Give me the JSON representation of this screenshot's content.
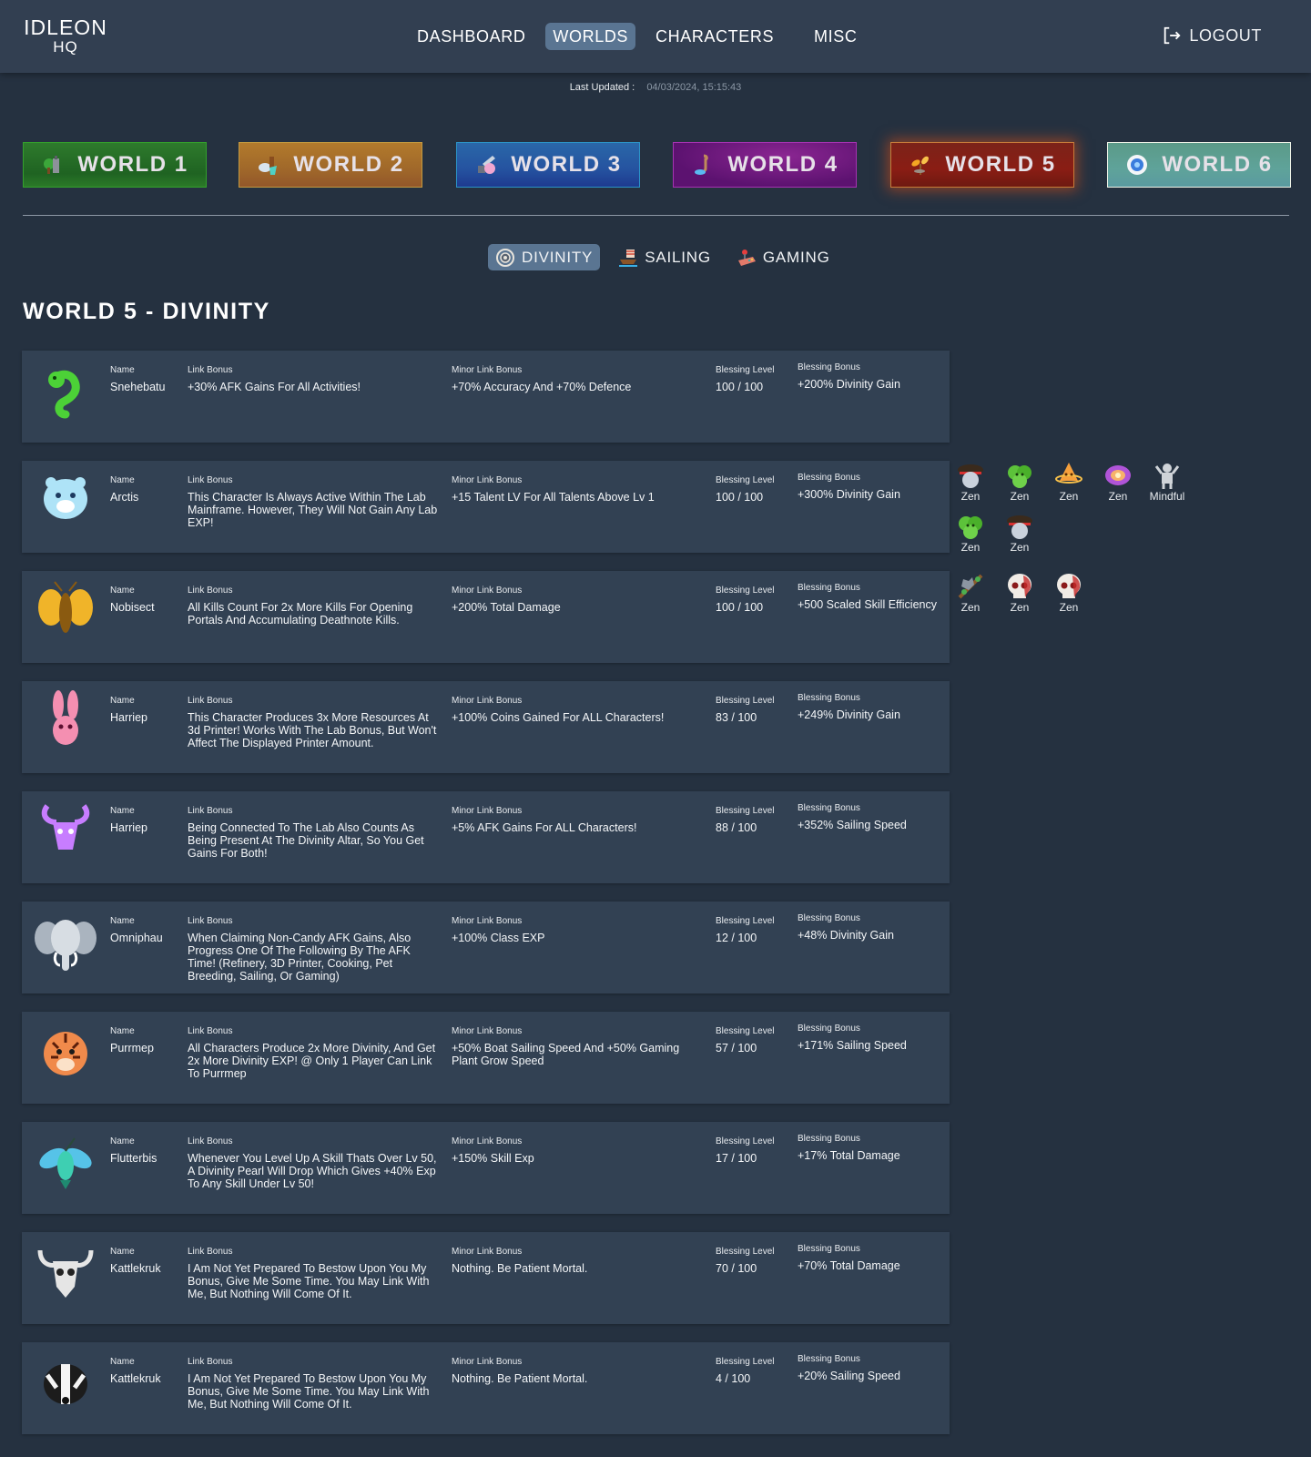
{
  "header": {
    "logo_line1": "IDLEON",
    "logo_line2": "HQ",
    "nav": [
      {
        "label": "DASHBOARD",
        "active": false
      },
      {
        "label": "WORLDS",
        "active": true
      },
      {
        "label": "CHARACTERS",
        "active": false
      },
      {
        "label": "MISC",
        "active": false
      }
    ],
    "logout_label": "LOGOUT",
    "logout_icon": "logout-icon"
  },
  "last_updated": {
    "label": "Last Updated :",
    "value": "04/03/2024, 15:15:43"
  },
  "worlds": [
    {
      "label": "WORLD 1",
      "icon": "world-1-icon",
      "active": false
    },
    {
      "label": "WORLD 2",
      "icon": "world-2-icon",
      "active": false
    },
    {
      "label": "WORLD 3",
      "icon": "world-3-icon",
      "active": false
    },
    {
      "label": "WORLD 4",
      "icon": "world-4-icon",
      "active": false
    },
    {
      "label": "WORLD 5",
      "icon": "world-5-icon",
      "active": true
    },
    {
      "label": "WORLD 6",
      "icon": "world-6-icon",
      "active": false
    }
  ],
  "subtabs": [
    {
      "label": "DIVINITY",
      "icon": "divinity-icon",
      "active": true
    },
    {
      "label": "SAILING",
      "icon": "sailing-ship-icon",
      "active": false
    },
    {
      "label": "GAMING",
      "icon": "gaming-joystick-icon",
      "active": false
    }
  ],
  "page_title": "WORLD 5 - DIVINITY",
  "column_labels": {
    "name": "Name",
    "link_bonus": "Link Bonus",
    "minor_link_bonus": "Minor Link Bonus",
    "blessing_level": "Blessing Level",
    "blessing_bonus": "Blessing Bonus"
  },
  "gods": [
    {
      "avatar": "snake-god-icon",
      "name": "Snehebatu",
      "link_bonus": "+30% AFK Gains For All Activities!",
      "minor_link_bonus": "+70% Accuracy And +70% Defence",
      "blessing_level": "100 / 100",
      "blessing_bonus": "+200% Divinity Gain",
      "color": "#4cd137"
    },
    {
      "avatar": "polar-bear-god-icon",
      "name": "Arctis",
      "link_bonus": "This Character Is Always Active Within The Lab Mainframe. However, They Will Not Gain Any Lab EXP!",
      "minor_link_bonus": "+15 Talent LV For All Talents Above Lv 1",
      "blessing_level": "100 / 100",
      "blessing_bonus": "+300% Divinity Gain",
      "color": "#aee3f7"
    },
    {
      "avatar": "moth-god-icon",
      "name": "Nobisect",
      "link_bonus": "All Kills Count For 2x More Kills For Opening Portals And Accumulating Deathnote Kills.",
      "minor_link_bonus": "+200% Total Damage",
      "blessing_level": "100 / 100",
      "blessing_bonus": "+500 Scaled Skill Efficiency",
      "color": "#f0b429"
    },
    {
      "avatar": "rabbit-god-icon",
      "name": "Harriep",
      "link_bonus": "This Character Produces 3x More Resources At 3d Printer! Works With The Lab Bonus, But Won't Affect The Displayed Printer Amount.",
      "minor_link_bonus": "+100% Coins Gained For ALL Characters!",
      "blessing_level": "83 / 100",
      "blessing_bonus": "+249% Divinity Gain",
      "color": "#f48fb1"
    },
    {
      "avatar": "goat-god-icon",
      "name": "Harriep",
      "link_bonus": "Being Connected To The Lab Also Counts As Being Present At The Divinity Altar, So You Get Gains For Both!",
      "minor_link_bonus": "+5% AFK Gains For ALL Characters!",
      "blessing_level": "88 / 100",
      "blessing_bonus": "+352% Sailing Speed",
      "color": "#c77dff"
    },
    {
      "avatar": "elephant-god-icon",
      "name": "Omniphau",
      "link_bonus": "When Claiming Non-Candy AFK Gains, Also Progress One Of The Following By The AFK Time! (Refinery, 3D Printer, Cooking, Pet Breeding, Sailing, Or Gaming)",
      "minor_link_bonus": "+100% Class EXP",
      "blessing_level": "12 / 100",
      "blessing_bonus": "+48% Divinity Gain",
      "color": "#d7dde3"
    },
    {
      "avatar": "tiger-god-icon",
      "name": "Purrmep",
      "link_bonus": "All Characters Produce 2x More Divinity, And Get 2x More Divinity EXP! @ Only 1 Player Can Link To Purrmep",
      "minor_link_bonus": "+50% Boat Sailing Speed And +50% Gaming Plant Grow Speed",
      "blessing_level": "57 / 100",
      "blessing_bonus": "+171% Sailing Speed",
      "color": "#f08a4b"
    },
    {
      "avatar": "hummingbird-god-icon",
      "name": "Flutterbis",
      "link_bonus": "Whenever You Level Up A Skill Thats Over Lv 50, A Divinity Pearl Will Drop Which Gives +40% Exp To Any Skill Under Lv 50!",
      "minor_link_bonus": "+150% Skill Exp",
      "blessing_level": "17 / 100",
      "blessing_bonus": "+17% Total Damage",
      "color": "#3ecfb2"
    },
    {
      "avatar": "bull-skull-god-icon",
      "name": "Kattlekruk",
      "link_bonus": "I Am Not Yet Prepared To Bestow Upon You My Bonus, Give Me Some Time. You May Link With Me, But Nothing Will Come Of It.",
      "minor_link_bonus": "Nothing. Be Patient Mortal.",
      "blessing_level": "70 / 100",
      "blessing_bonus": "+70% Total Damage",
      "color": "#e5e5e5"
    },
    {
      "avatar": "badger-god-icon",
      "name": "Kattlekruk",
      "link_bonus": "I Am Not Yet Prepared To Bestow Upon You My Bonus, Give Me Some Time. You May Link With Me, But Nothing Will Come Of It.",
      "minor_link_bonus": "Nothing. Be Patient Mortal.",
      "blessing_level": "4 / 100",
      "blessing_bonus": "+20% Sailing Speed",
      "color": "#f5f5f5"
    }
  ],
  "linked_characters": {
    "arctis": [
      {
        "name": "Zen",
        "icon": "pirate-hat-orb-icon"
      },
      {
        "name": "Zen",
        "icon": "green-bush-icon"
      },
      {
        "name": "Zen",
        "icon": "orange-planet-icon"
      },
      {
        "name": "Zen",
        "icon": "purple-galaxy-icon"
      },
      {
        "name": "Mindful",
        "icon": "statue-icon"
      },
      {
        "name": "Zen",
        "icon": "green-bush-icon"
      },
      {
        "name": "Zen",
        "icon": "pirate-hat-orb-icon"
      }
    ],
    "nobisect": [
      {
        "name": "Zen",
        "icon": "wolf-branch-icon"
      },
      {
        "name": "Zen",
        "icon": "bloody-skull-icon"
      },
      {
        "name": "Zen",
        "icon": "bloody-skull-icon"
      }
    ]
  }
}
